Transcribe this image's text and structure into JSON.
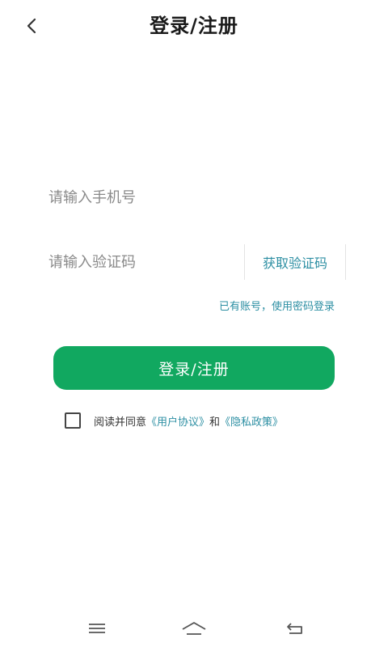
{
  "header": {
    "title": "登录/注册",
    "back_icon": "chevron-left-icon"
  },
  "form": {
    "phone_placeholder": "请输入手机号",
    "code_placeholder": "请输入验证码",
    "get_code_label": "获取验证码",
    "password_login_link": "已有账号，使用密码登录",
    "submit_label": "登录/注册"
  },
  "agreement": {
    "prefix": "阅读并同意",
    "user_agreement": "《用户协议》",
    "conjunction": "和",
    "privacy_policy": "《隐私政策》",
    "checked": false
  },
  "nav": {
    "menu_icon": "menu-icon",
    "home_icon": "home-icon",
    "back_icon": "back-icon"
  },
  "colors": {
    "accent_green": "#11a860",
    "link_blue": "#2d8fa3",
    "background": "#ffffff"
  }
}
